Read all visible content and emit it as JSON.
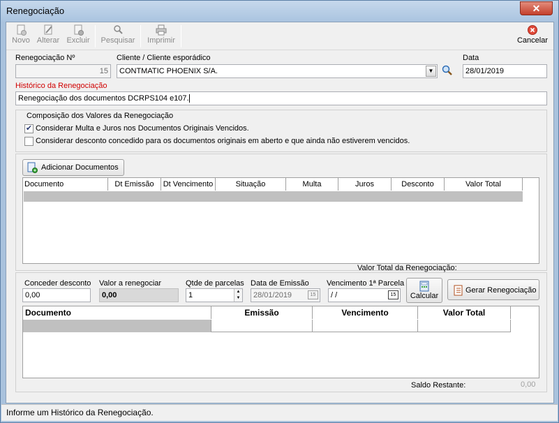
{
  "window": {
    "title": "Renegociação",
    "close_glyph": "✕"
  },
  "toolbar": {
    "novo": "Novo",
    "alterar": "Alterar",
    "excluir": "Excluir",
    "pesquisar": "Pesquisar",
    "imprimir": "Imprimir",
    "cancelar": "Cancelar"
  },
  "form": {
    "renegociacao_label": "Renegociação Nº",
    "renegociacao_value": "15",
    "cliente_label": "Cliente / Cliente esporádico",
    "cliente_value": "CONTMATIC PHOENIX S/A.",
    "data_label": "Data",
    "data_value": "28/01/2019",
    "historico_label": "Histórico da Renegociação",
    "historico_value": "Renegociação dos documentos DCRPS104 e107."
  },
  "composicao": {
    "title": "Composição dos Valores da Renegociação",
    "check1_label": "Considerar Multa e Juros nos Documentos Originais Vencidos.",
    "check1_checked": true,
    "check2_label": "Considerar desconto concedido para os documentos originais em aberto e que ainda não estiverem vencidos.",
    "check2_checked": false
  },
  "adicionar_button": "Adicionar Documentos",
  "docs_grid": {
    "columns": [
      "Documento",
      "Dt Emissão",
      "Dt Vencimento",
      "Situação",
      "Multa",
      "Juros",
      "Desconto",
      "Valor Total"
    ],
    "total_label": "Valor Total da Renegociação:"
  },
  "parcelas": {
    "desconto_label": "Conceder desconto",
    "desconto_value": "0,00",
    "valor_label": "Valor a renegociar",
    "valor_value": "0,00",
    "qtde_label": "Qtde de parcelas",
    "qtde_value": "1",
    "emissao_label": "Data de Emissão",
    "emissao_value": "28/01/2019",
    "vencimento_label": "Vencimento 1ª Parcela",
    "vencimento_value": " / /",
    "calcular_button": "Calcular",
    "gerar_button": "Gerar Renegociação"
  },
  "parcelas_grid": {
    "columns": [
      "Documento",
      "Emissão",
      "Vencimento",
      "Valor Total"
    ],
    "saldo_label": "Saldo Restante:",
    "saldo_value": "0,00"
  },
  "status": {
    "message": "Informe um Histórico da Renegociação."
  },
  "colors": {
    "accent_red": "#d00000",
    "title_bar": "#aac4e0"
  }
}
